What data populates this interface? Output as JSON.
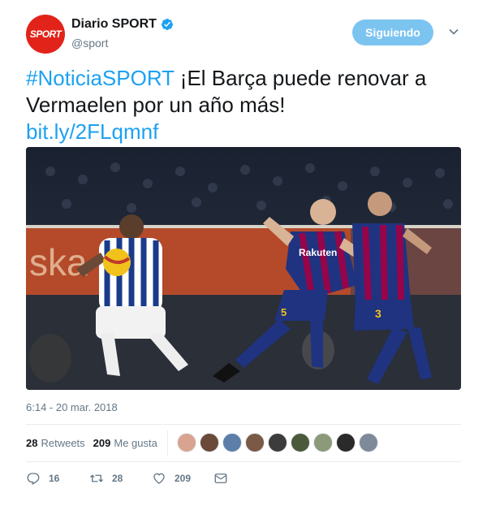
{
  "account": {
    "avatar_text": "SPORT",
    "name": "Diario SPORT",
    "handle": "@sport",
    "verified": true,
    "follow_label": "Siguiendo"
  },
  "tweet": {
    "hashtag": "#NoticiaSPORT",
    "text": " ¡El Barça puede renovar a Vermaelen por un año más!",
    "link": "bit.ly/2FLqmnf",
    "media": {
      "ad_board_text": "ska",
      "rakuten_text": "Rakuten",
      "player_numbers": [
        "5",
        "3"
      ]
    }
  },
  "timestamp": "6:14 - 20 mar. 2018",
  "stats": {
    "retweets_count": "28",
    "retweets_label": "Retweets",
    "likes_count": "209",
    "likes_label": "Me gusta"
  },
  "likers": [
    "#d8a48f",
    "#6b4a3a",
    "#5c7ea8",
    "#7a5a46",
    "#3c3c3c",
    "#4a5a3a",
    "#8c9a7a",
    "#2a2a2a",
    "#7e8a99"
  ],
  "actions": {
    "reply_count": "16",
    "retweet_count": "28",
    "like_count": "209"
  },
  "colors": {
    "link_blue": "#1da1f2",
    "follow_button_bg": "#7cc4f0",
    "brand_red": "#e2231a"
  }
}
